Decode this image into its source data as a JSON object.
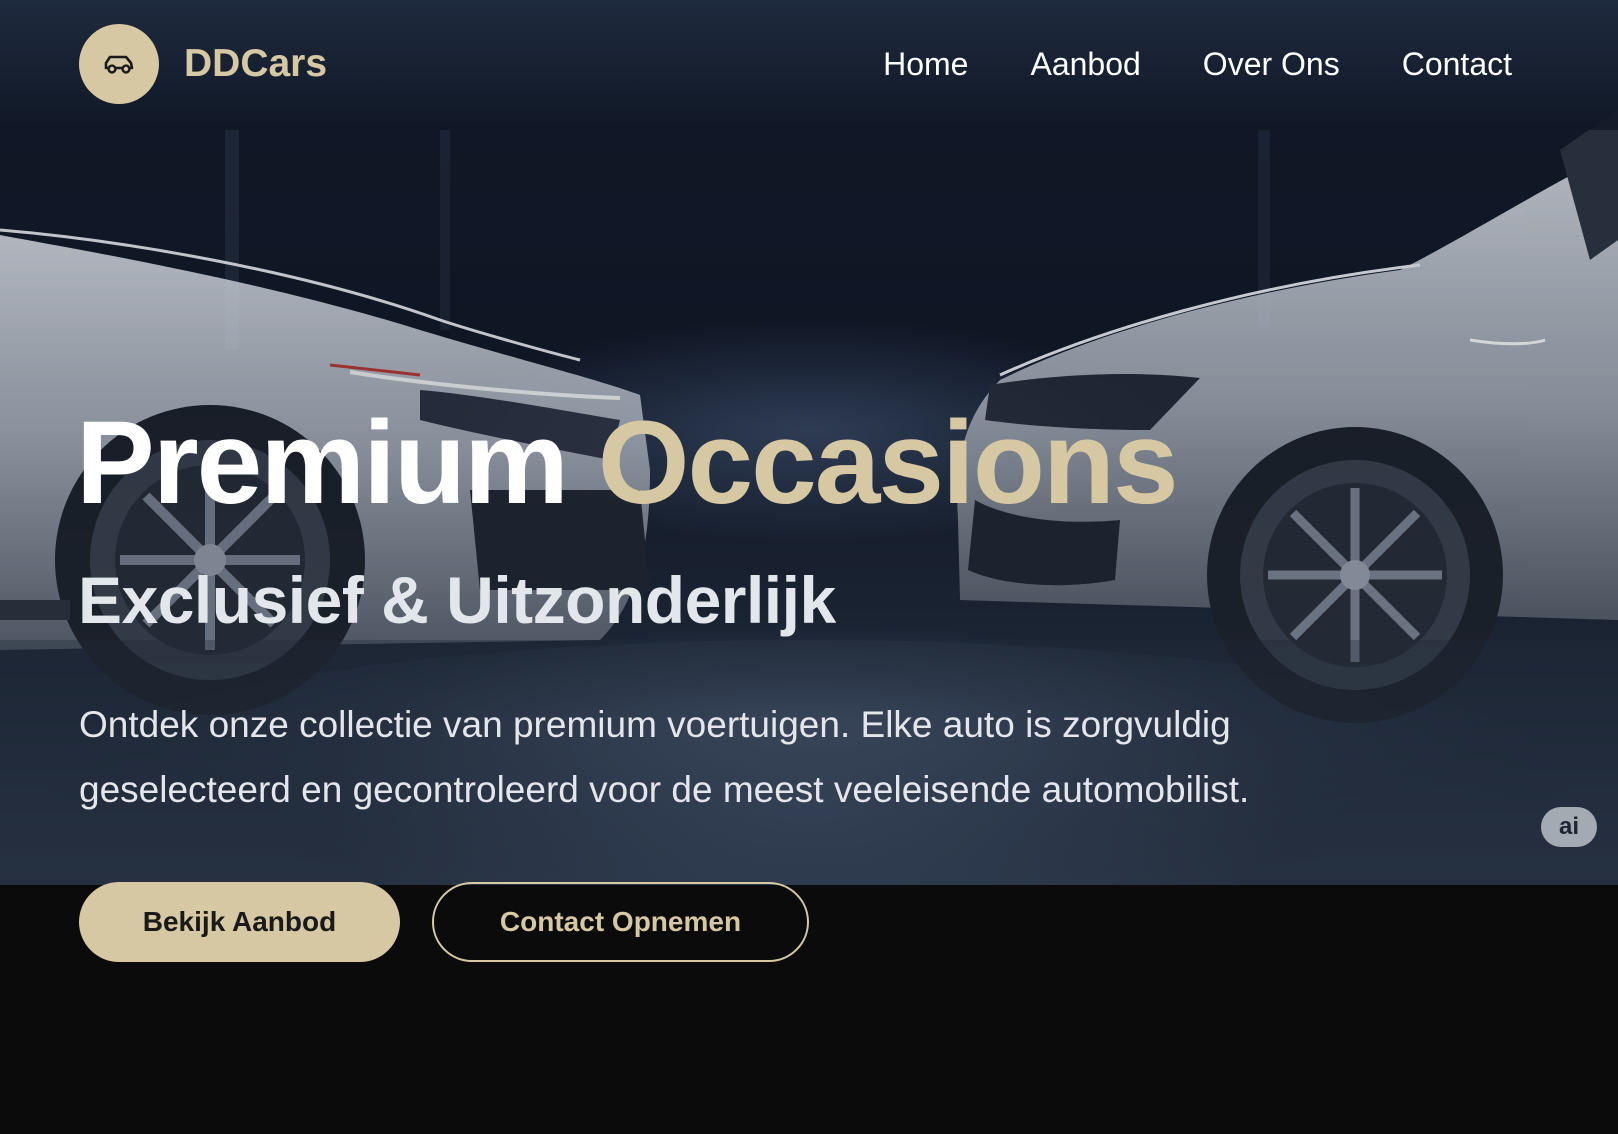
{
  "brand": {
    "name": "DDCars",
    "logo_icon": "car-icon",
    "accent_color": "#d6c8a2"
  },
  "nav": {
    "items": [
      {
        "label": "Home"
      },
      {
        "label": "Aanbod"
      },
      {
        "label": "Over Ons"
      },
      {
        "label": "Contact"
      }
    ]
  },
  "hero": {
    "title_part1": "Premium",
    "title_part2": "Occasions",
    "subtitle": "Exclusief & Uitzonderlijk",
    "description": "Ontdek onze collectie van premium voertuigen. Elke auto is zorgvuldig geselecteerd en gecontroleerd voor de meest veeleisende automobilist.",
    "badge": "ai"
  },
  "actions": {
    "primary_label": "Bekijk Aanbod",
    "secondary_label": "Contact Opnemen"
  }
}
